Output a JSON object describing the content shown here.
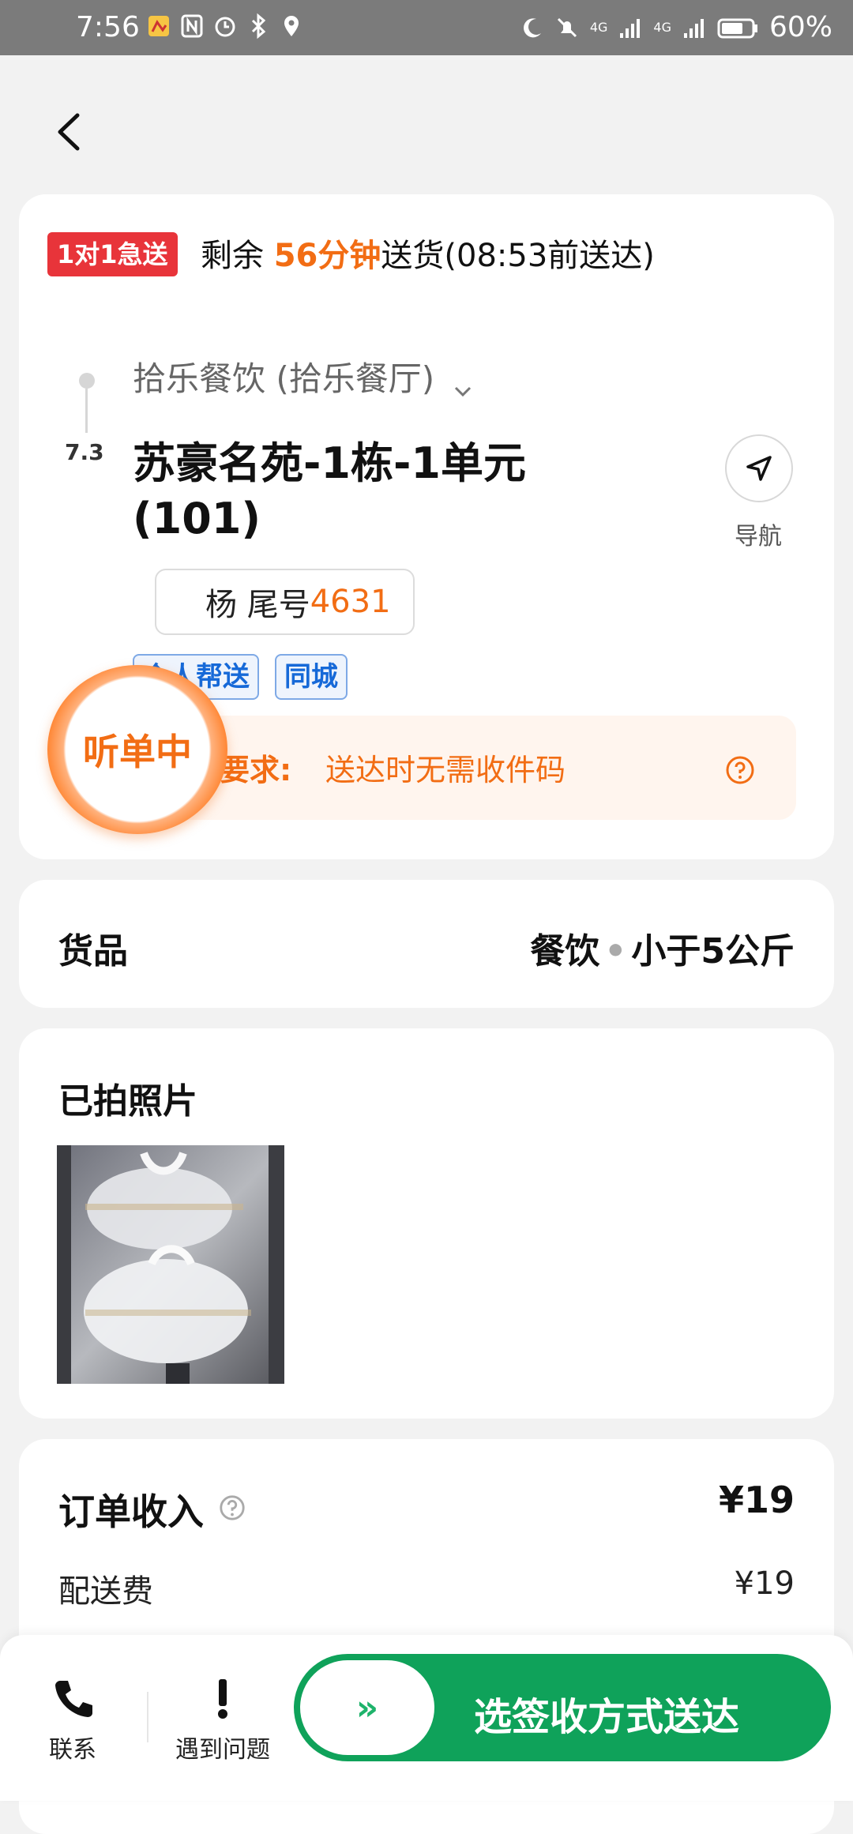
{
  "status_bar": {
    "time": "7:56",
    "battery": "60%",
    "net1": "4G",
    "net2": "4G"
  },
  "order": {
    "badge": "1对1急送",
    "remain_prefix": "剩余 ",
    "remain_minutes": "56分钟",
    "remain_suffix": "送货(08:53前送达)",
    "merchant": "拾乐餐饮 (拾乐餐厅)",
    "distance": "7.3",
    "address": "苏豪名苑-1栋-1单元 (101)",
    "nav_label": "导航",
    "customer_name": "杨 尾号",
    "customer_tail": "4631",
    "tags": [
      "个人帮送",
      "同城"
    ],
    "requirement_label": "配送要求:",
    "requirement_value": "送达时无需收件码",
    "listening_badge": "听单中"
  },
  "goods": {
    "title": "货品",
    "category": "餐饮",
    "weight": "小于5公斤"
  },
  "photos": {
    "title": "已拍照片"
  },
  "income": {
    "title": "订单收入",
    "total": "¥19",
    "fee_label": "配送费",
    "fee_value": "¥19"
  },
  "bottom": {
    "contact": "联系",
    "problem": "遇到问题",
    "slide_action": "选签收方式送达",
    "slide_arrows": "»"
  },
  "colors": {
    "accent_orange": "#f26d14",
    "brand_green": "#0fa25a",
    "urgent_red": "#e8343a",
    "tag_blue": "#1669d8"
  }
}
